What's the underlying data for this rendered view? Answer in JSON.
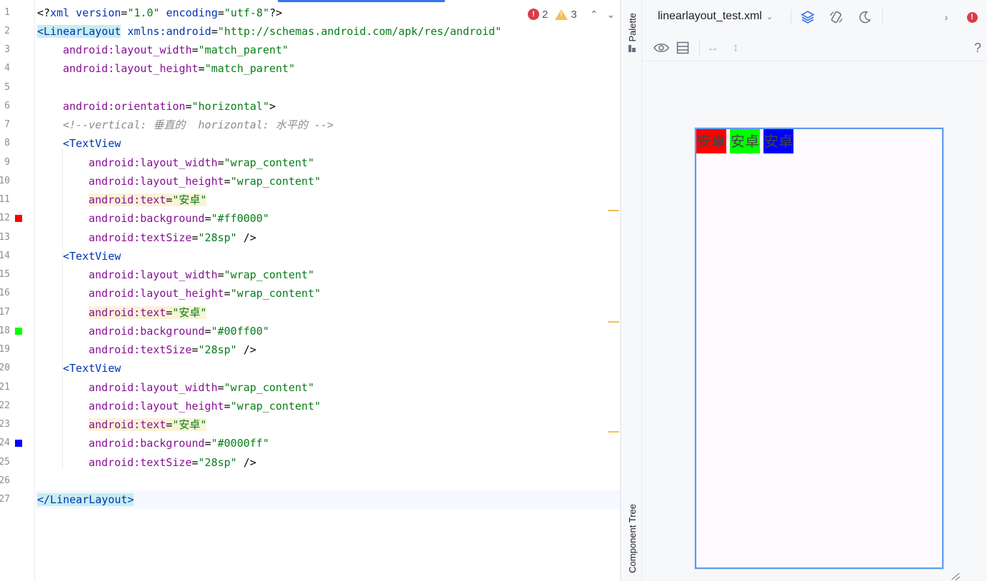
{
  "editor": {
    "errors_count": "2",
    "warnings_count": "3",
    "lines": [
      {
        "n": "1"
      },
      {
        "n": "2"
      },
      {
        "n": "3"
      },
      {
        "n": "4"
      },
      {
        "n": "5"
      },
      {
        "n": "6"
      },
      {
        "n": "7"
      },
      {
        "n": "8"
      },
      {
        "n": "9"
      },
      {
        "n": "10"
      },
      {
        "n": "11"
      },
      {
        "n": "12"
      },
      {
        "n": "13"
      },
      {
        "n": "14"
      },
      {
        "n": "15"
      },
      {
        "n": "16"
      },
      {
        "n": "17"
      },
      {
        "n": "18"
      },
      {
        "n": "19"
      },
      {
        "n": "20"
      },
      {
        "n": "21"
      },
      {
        "n": "22"
      },
      {
        "n": "23"
      },
      {
        "n": "24"
      },
      {
        "n": "25"
      },
      {
        "n": "26"
      },
      {
        "n": "27"
      }
    ],
    "code": {
      "l1": {
        "a": "<?",
        "b": "xml version",
        "c": "=",
        "d": "\"1.0\"",
        "e": " encoding",
        "f": "=",
        "g": "\"utf-8\"",
        "h": "?>"
      },
      "l2": {
        "tag": "<LinearLayout",
        "attr": " xmlns:android",
        "eq": "=",
        "val": "\"http://schemas.android.com/apk/res/android\""
      },
      "l3": {
        "ns": "android:",
        "attr": "layout_width",
        "eq": "=",
        "val": "\"match_parent\""
      },
      "l4": {
        "ns": "android:",
        "attr": "layout_height",
        "eq": "=",
        "val": "\"match_parent\""
      },
      "l6": {
        "ns": "android:",
        "attr": "orientation",
        "eq": "=",
        "val": "\"horizontal\"",
        "end": ">"
      },
      "l7": {
        "cmt": "<!--vertical: 垂直的  horizontal: 水平的 -->"
      },
      "l8": {
        "tag": "<TextView"
      },
      "l9": {
        "ns": "android:",
        "attr": "layout_width",
        "eq": "=",
        "val": "\"wrap_content\""
      },
      "l10": {
        "ns": "android:",
        "attr": "layout_height",
        "eq": "=",
        "val": "\"wrap_content\""
      },
      "l11": {
        "ns": "android:",
        "attr": "text",
        "eq": "=",
        "val": "\"安卓\""
      },
      "l12": {
        "ns": "android:",
        "attr": "background",
        "eq": "=",
        "val": "\"#ff0000\""
      },
      "l13": {
        "ns": "android:",
        "attr": "textSize",
        "eq": "=",
        "val": "\"28sp\"",
        "end": " />"
      },
      "l14": {
        "tag": "<TextView"
      },
      "l15": {
        "ns": "android:",
        "attr": "layout_width",
        "eq": "=",
        "val": "\"wrap_content\""
      },
      "l16": {
        "ns": "android:",
        "attr": "layout_height",
        "eq": "=",
        "val": "\"wrap_content\""
      },
      "l17": {
        "ns": "android:",
        "attr": "text",
        "eq": "=",
        "val": "\"安卓\""
      },
      "l18": {
        "ns": "android:",
        "attr": "background",
        "eq": "=",
        "val": "\"#00ff00\""
      },
      "l19": {
        "ns": "android:",
        "attr": "textSize",
        "eq": "=",
        "val": "\"28sp\"",
        "end": " />"
      },
      "l20": {
        "tag": "<TextView"
      },
      "l21": {
        "ns": "android:",
        "attr": "layout_width",
        "eq": "=",
        "val": "\"wrap_content\""
      },
      "l22": {
        "ns": "android:",
        "attr": "layout_height",
        "eq": "=",
        "val": "\"wrap_content\""
      },
      "l23": {
        "ns": "android:",
        "attr": "text",
        "eq": "=",
        "val": "\"安卓\""
      },
      "l24": {
        "ns": "android:",
        "attr": "background",
        "eq": "=",
        "val": "\"#0000ff\""
      },
      "l25": {
        "ns": "android:",
        "attr": "textSize",
        "eq": "=",
        "val": "\"28sp\"",
        "end": " />"
      },
      "l27": {
        "tag": "</LinearLayout",
        "end": ">"
      }
    },
    "swatch_colors": [
      "#ff0000",
      "#00ff00",
      "#0000ff"
    ]
  },
  "side_strip": {
    "palette_label": "Palette",
    "component_tree_label": "Component Tree"
  },
  "design": {
    "file_name": "linearlayout_test.xml",
    "help_label": "?",
    "preview": {
      "views": [
        {
          "text": "安卓",
          "background": "#ff0000"
        },
        {
          "text": "安卓",
          "background": "#00ff00"
        },
        {
          "text": "安卓",
          "background": "#0000ff"
        }
      ]
    }
  }
}
